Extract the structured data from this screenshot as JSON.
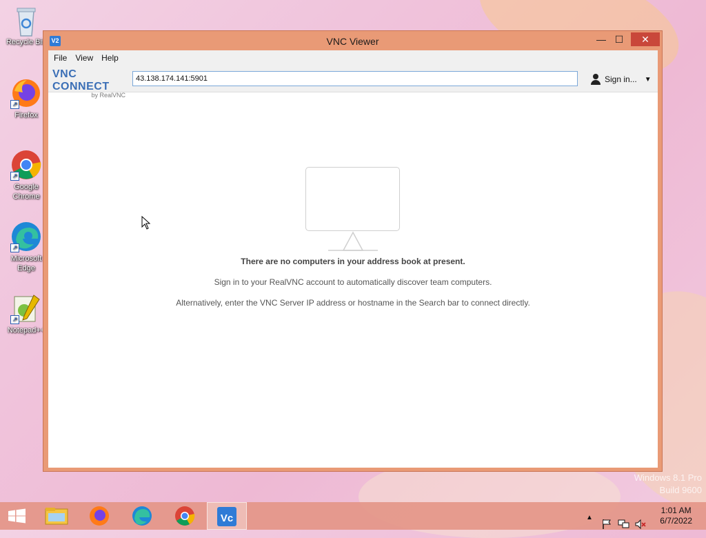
{
  "desktop": {
    "icons": [
      {
        "label": "Recycle Bin",
        "icon": "recycle-bin-icon"
      },
      {
        "label": "Firefox",
        "icon": "firefox-icon"
      },
      {
        "label": "Google Chrome",
        "icon": "chrome-icon"
      },
      {
        "label": "Microsoft Edge",
        "icon": "edge-icon"
      },
      {
        "label": "Notepad++",
        "icon": "notepad-plus-plus-icon"
      }
    ],
    "watermark_line1": "Windows 8.1 Pro",
    "watermark_line2": "Build 9600"
  },
  "window": {
    "title": "VNC Viewer",
    "menu": [
      "File",
      "View",
      "Help"
    ],
    "logo_main": "VNC CONNECT",
    "logo_sub": "by RealVNC",
    "search_value": "43.138.174.141:5901",
    "signin_label": "Sign in...",
    "empty_title": "There are no computers in your address book at present.",
    "empty_line1": "Sign in to your RealVNC account to automatically discover team computers.",
    "empty_line2": "Alternatively, enter the VNC Server IP address or hostname in the Search bar to connect directly."
  },
  "taskbar": {
    "apps": [
      "start-icon",
      "file-explorer-icon",
      "firefox-icon",
      "edge-icon",
      "chrome-icon",
      "vnc-viewer-icon"
    ],
    "time": "1:01 AM",
    "date": "6/7/2022"
  },
  "colors": {
    "window_frame": "#e99a76",
    "close_button": "#c9473a",
    "taskbar": "#e49688",
    "accent": "#3b6fb6"
  }
}
